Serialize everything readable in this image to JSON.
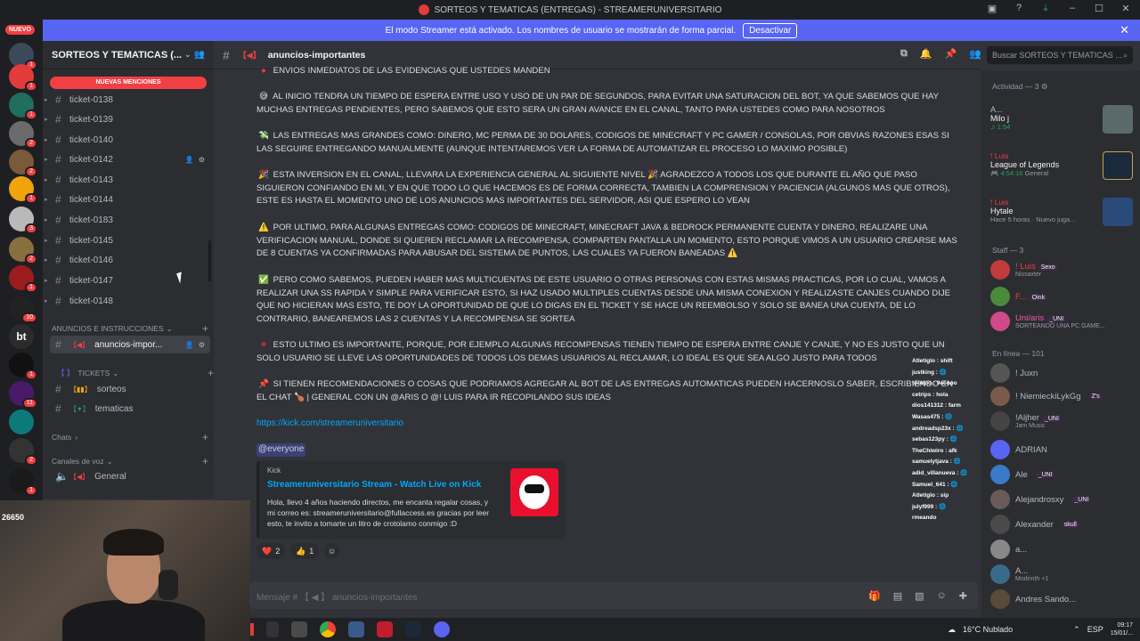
{
  "window": {
    "title": "SORTEOS Y TEMATICAS (ENTREGAS) - STREAMERUNIVERSITARIO"
  },
  "banner": {
    "text": "El modo Streamer está activado. Los nombres de usuario se mostrarán de forma parcial.",
    "button": "Desactivar"
  },
  "rail": {
    "nuevo": "NUEVO",
    "badges": [
      "1",
      "1",
      "1",
      "2",
      "2",
      "1",
      "3",
      "2",
      "1",
      "10",
      "1",
      "11",
      "2",
      "1"
    ],
    "server_initials": "bt"
  },
  "server": {
    "name": "SORTEOS Y TEMATICAS (...",
    "new_mentions": "NUEVAS MENCIONES"
  },
  "channels": [
    "ticket-0138",
    "ticket-0139",
    "ticket-0140",
    "ticket-0142",
    "ticket-0143",
    "ticket-0144",
    "ticket-0183",
    "ticket-0145",
    "ticket-0146",
    "ticket-0147",
    "ticket-0148"
  ],
  "categories": {
    "anuncios": "ANUNCIOS E INSTRUCCIONES",
    "tickets": "TICKETS",
    "chats": "Chats",
    "voz": "Canales de voz"
  },
  "announce_channel": "anuncios-impor...",
  "sub_channels": [
    "sorteos",
    "tematicas"
  ],
  "voice_channel": "General",
  "webcam": {
    "count": "26650"
  },
  "header": {
    "channel": "anuncios-importantes"
  },
  "search": {
    "placeholder": "Buscar SORTEOS Y TEMATICAS ..."
  },
  "messages": {
    "p0": "ENVIOS INMEDIATOS DE LAS EVIDENCIAS QUE USTEDES MANDEN",
    "p1": "AL INICIO TENDRA UN TIEMPO DE ESPERA ENTRE USO Y USO DE UN PAR DE SEGUNDOS, PARA EVITAR UNA SATURACION DEL BOT, YA QUE SABEMOS QUE HAY MUCHAS ENTREGAS PENDIENTES, PERO SABEMOS QUE ESTO SERA UN GRAN AVANCE EN EL CANAL, TANTO PARA USTEDES COMO PARA NOSOTROS",
    "p2": "LAS ENTREGAS MAS GRANDES COMO: DINERO, MC PERMA DE 30 DOLARES, CODIGOS DE MINECRAFT Y PC GAMER / CONSOLAS, POR OBVIAS RAZONES ESAS SI LAS SEGUIRE ENTREGANDO MANUALMENTE (AUNQUE INTENTAREMOS VER LA FORMA DE AUTOMATIZAR EL PROCESO LO MAXIMO POSIBLE)",
    "p3": "ESTA INVERSION EN EL CANAL, LLEVARA LA EXPERIENCIA GENERAL AL SIGUIENTE NIVEL 🎉 AGRADEZCO A TODOS LOS QUE DURANTE EL AÑO QUE PASO SIGUIERON CONFIANDO EN MI, Y EN QUE TODO LO QUE HACEMOS ES DE FORMA CORRECTA, TAMBIEN LA COMPRENSION Y PACIENCIA (ALGUNOS MAS QUE OTROS), ESTE ES HASTA EL MOMENTO UNO DE LOS ANUNCIOS MAS IMPORTANTES DEL SERVIDOR, ASI QUE ESPERO LO VEAN",
    "p4": "POR ULTIMO, PARA ALGUNAS ENTREGAS COMO: CODIGOS DE MINECRAFT, MINECRAFT JAVA & BEDROCK PERMANENTE CUENTA Y DINERO, REALIZARE UNA VERIFICACION MANUAL, DONDE SI QUIEREN RECLAMAR LA RECOMPENSA, COMPARTEN PANTALLA UN MOMENTO, ESTO PORQUE VIMOS A UN USUARIO CREARSE MAS DE 8 CUENTAS YA CONFIRMADAS PARA ABUSAR DEL SISTEMA DE PUNTOS, LAS CUALES YA FUERON BANEADAS ⚠️",
    "p5": "PERO COMO SABEMOS, PUEDEN HABER MAS MULTICUENTAS DE ESTE USUARIO O OTRAS PERSONAS CON ESTAS MISMAS PRACTICAS, POR LO CUAL, VAMOS A REALIZAR UNA SS RAPIDA Y SIMPLE PARA VERIFICAR ESTO, SI HAZ USADO MULTIPLES CUENTAS DESDE UNA MISMA CONEXION Y REALIZASTE CANJES CUANDO DIJE QUE NO HICIERAN MAS ESTO, TE DOY LA OPORTUNIDAD DE QUE LO DIGAS EN EL TICKET Y SE HACE UN REEMBOLSO Y SOLO SE BANEA UNA CUENTA, DE LO CONTRARIO, BANEAREMOS LAS 2 CUENTAS Y LA RECOMPENSA SE SORTEA",
    "p6": "ESTO ULTIMO ES IMPORTANTE, PORQUE, POR EJEMPLO ALGUNAS RECOMPENSAS TIENEN TIEMPO DE ESPERA ENTRE CANJE Y CANJE, Y NO ES JUSTO QUE UN SOLO USUARIO SE LLEVE LAS OPORTUNIDADES DE TODOS LOS DEMAS USUARIOS AL RECLAMAR, LO IDEAL ES QUE SEA ALGO JUSTO PARA TODOS",
    "p7": "SI TIENEN RECOMENDACIONES O COSAS QUE PODRIAMOS AGREGAR AL BOT DE LAS ENTREGAS AUTOMATICAS PUEDEN HACERNOSLO SABER, ESCRIBIENDO EN EL CHAT 🍗 | general  CON UN @aris  O @! Luis  PARA IR RECOPILANDO SUS IDEAS",
    "link": "https://kick.com/streameruniversitario",
    "mention": "@everyone"
  },
  "embed": {
    "provider": "Kick",
    "title": "Streameruniversitario Stream - Watch Live on Kick",
    "description": "Hola, llevo 4 años haciendo directos, me encanta regalar cosas, y mi correo es: streameruniversitario@fullaccess.es gracias por leer esto, te invito a tomarte un litro de crotolamo conmigo :D"
  },
  "reactions": [
    {
      "emoji": "❤️",
      "count": "2"
    },
    {
      "emoji": "👍",
      "count": "1"
    }
  ],
  "composer": {
    "placeholder": "Mensaje # 【 ◀ 】 anuncios-importantes"
  },
  "activity": {
    "header": "Actividad — 3",
    "items": [
      {
        "name": "A...",
        "game": "Milo j",
        "time": "1:54"
      },
      {
        "name": "! Luis",
        "game": "League of Legends",
        "time": "4:54:16",
        "extra": "General"
      },
      {
        "name": "! Luis",
        "game": "Hytale",
        "time": "Hace 5 horas",
        "extra": "Nuevo juga..."
      }
    ]
  },
  "staff": {
    "header": "Staff — 3",
    "members": [
      {
        "name": "! Luis",
        "tag": "Sexo",
        "status": "Nissaxter"
      },
      {
        "name": "F...",
        "tag": "Oink",
        "status": ""
      },
      {
        "name": "Uni/aris",
        "tag": "_UNI",
        "status": "SORTEANDO UNA PC GAME..."
      }
    ]
  },
  "online": {
    "header": "En línea — 101",
    "members": [
      {
        "name": "! Juxn",
        "tag": "",
        "status": ""
      },
      {
        "name": "! NiemieckiLykGg",
        "tag": "Z's",
        "status": ""
      },
      {
        "name": "!Aljher",
        "tag": "_UNI",
        "status": "Jam Music"
      },
      {
        "name": "ADRIAN",
        "tag": "",
        "status": ""
      },
      {
        "name": "Ale",
        "tag": "_UNI",
        "status": ""
      },
      {
        "name": "Alejandrosxy",
        "tag": "_UNI",
        "status": ""
      },
      {
        "name": "Alexander",
        "tag": "skull",
        "status": ""
      },
      {
        "name": "a...",
        "tag": "",
        "status": ""
      },
      {
        "name": "A...",
        "tag": "",
        "status": "Modrinth +1"
      },
      {
        "name": "Andres Sando...",
        "tag": "",
        "status": ""
      }
    ]
  },
  "chat_overlay": [
    "Atletiglo : shift",
    "justking : 🌐",
    "toodoo : 9ecooo",
    "cetrips : hola",
    "dios141312 : farm",
    "Wasas475 : 🌐",
    "andreadsp23x : 🌐",
    "sebas123py : 🌐",
    "TheChiwiro : afk",
    "samuelytjava : 🌐",
    "adid_villanueva : 🌐",
    "Samuel_641 : 🌐",
    "Atletiglo : sip",
    "julyf999 : 🌐",
    "rmeando"
  ],
  "taskbar": {
    "weather": "16°C  Nublado",
    "lang": "ESP",
    "time": "09:17",
    "date": "15/01/..."
  }
}
